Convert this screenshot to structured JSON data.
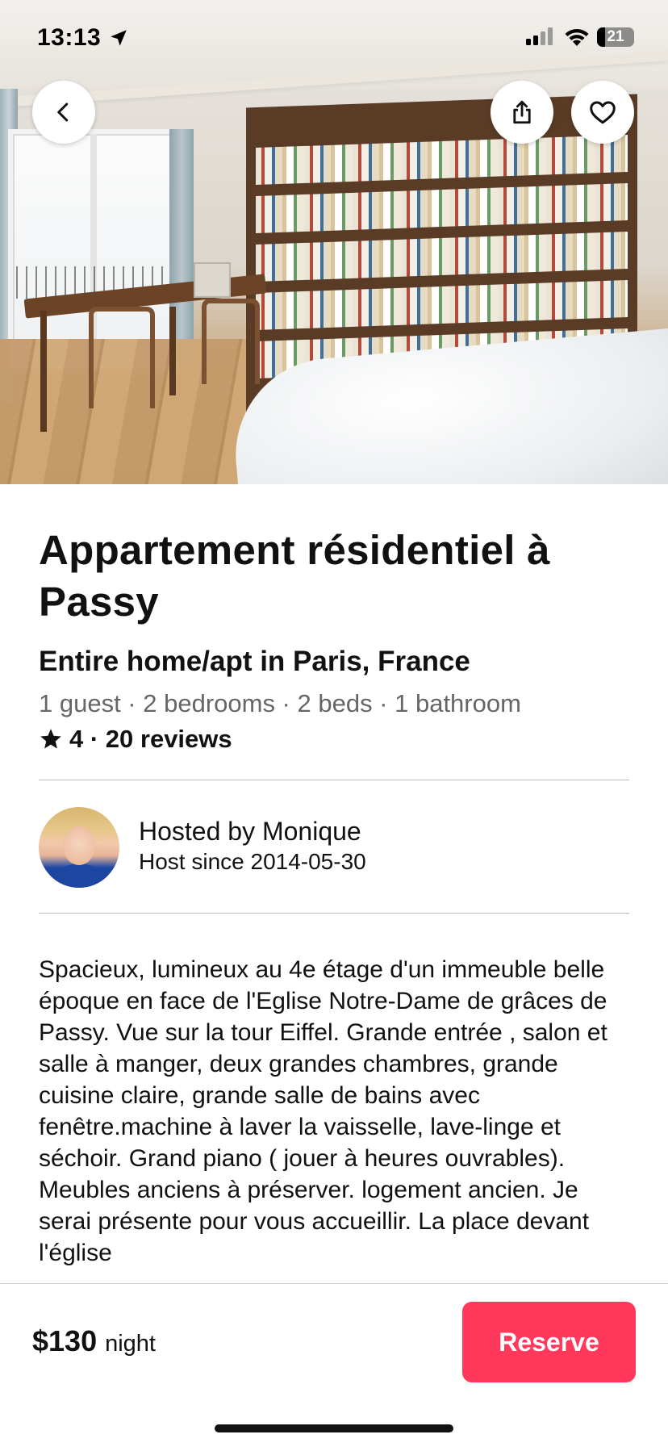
{
  "status_bar": {
    "time": "13:13",
    "battery": "21"
  },
  "listing": {
    "title": "Appartement résidentiel à Passy",
    "subtitle": "Entire home/apt in Paris, France",
    "details": "1 guest · 2 bedrooms · 2 beds · 1 bathroom",
    "rating": "4 · 20 reviews",
    "description": "Spacieux, lumineux au 4e étage d'un immeuble belle époque en face de  l'Eglise Notre-Dame de grâces de Passy. Vue sur la tour Eiffel. Grande entrée , salon et salle à manger, deux grandes chambres, grande cuisine claire, grande salle de bains avec fenêtre.machine à laver la vaisselle, lave-linge et séchoir. Grand piano ( jouer à heures ouvrables). Meubles anciens à préserver. logement ancien. Je  serai présente pour vous accueillir. La place devant l'église"
  },
  "host": {
    "name_line": "Hosted by Monique",
    "since_line": "Host since 2014-05-30"
  },
  "booking": {
    "price": "$130",
    "unit": "night",
    "reserve_label": "Reserve"
  },
  "icons": {
    "back": "chevron-left-icon",
    "share": "share-icon",
    "favorite": "heart-icon",
    "star": "star-icon"
  },
  "colors": {
    "accent": "#ff385c"
  }
}
